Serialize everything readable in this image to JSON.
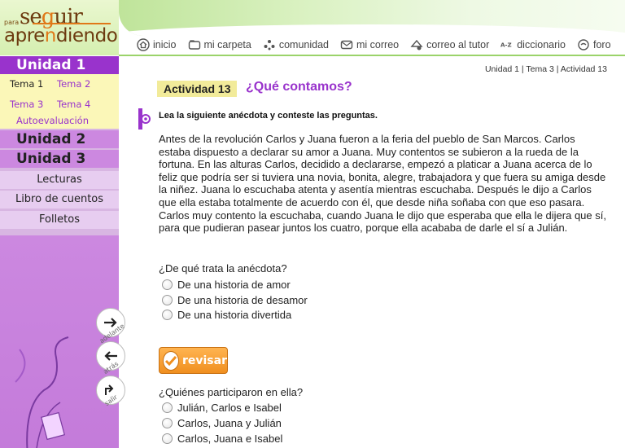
{
  "logo": {
    "small": "para",
    "seguir_a": "se",
    "seguir_b": "g",
    "seguir_c": "uir",
    "apr_a": "apre",
    "apr_b": "n",
    "apr_c": "diendo"
  },
  "nav": [
    {
      "label": "inicio",
      "icon": "home-icon"
    },
    {
      "label": "mi carpeta",
      "icon": "folder-icon"
    },
    {
      "label": "comunidad",
      "icon": "community-icon"
    },
    {
      "label": "mi correo",
      "icon": "mail-icon"
    },
    {
      "label": "correo al tutor",
      "icon": "tutor-mail-icon"
    },
    {
      "label": "diccionario",
      "icon": "dictionary-icon"
    },
    {
      "label": "foro",
      "icon": "forum-icon"
    }
  ],
  "sidebar": {
    "unidad1": "Unidad 1",
    "temas": [
      "Tema 1",
      "Tema 2",
      "Tema 3",
      "Tema 4"
    ],
    "autoevaluacion": "Autoevaluación",
    "unidad2": "Unidad 2",
    "unidad3": "Unidad 3",
    "links": [
      "Lecturas",
      "Libro de cuentos",
      "Folletos"
    ],
    "adelante": "adelante",
    "atras": "atrás",
    "salir": "salir"
  },
  "breadcrumb": "Unidad 1 |  Tema 3 | Actividad 13",
  "activity": {
    "badge": "Actividad 13",
    "title": "¿Qué contamos?"
  },
  "instruction": "Lea la siguiente anécdota y conteste las preguntas.",
  "story": "Antes de la revolución Carlos y Juana fueron a la feria del pueblo de San Marcos. Carlos estaba dispuesto a declarar su amor a Juana. Muy contentos se subieron a la rueda de la fortuna. En las alturas Carlos, decidido a declararse, empezó a platicar a Juana acerca de lo feliz que podría ser si tuviera una novia, bonita, alegre, trabajadora y que fuera su amiga desde la niñez. Juana lo escuchaba atenta y asentía mientras escuchaba. Después le dijo a Carlos que ella estaba totalmente de acuerdo con él, que desde niña soñaba con que eso pasara. Carlos muy contento la escuchaba, cuando Juana le dijo que esperaba que ella le dijera que sí, para que pudieran pasear juntos los cuatro, porque ella acababa de darle el sí a Julián.",
  "questions": [
    {
      "text": "¿De qué trata la anécdota?",
      "options": [
        "De una historia de amor",
        "De una historia de desamor",
        "De una historia divertida"
      ]
    },
    {
      "text": "¿Quiénes participaron en ella?",
      "options": [
        "Julián, Carlos e Isabel",
        "Carlos, Juana y Julián",
        "Carlos, Juana e Isabel"
      ]
    }
  ],
  "revisar": "revisar"
}
